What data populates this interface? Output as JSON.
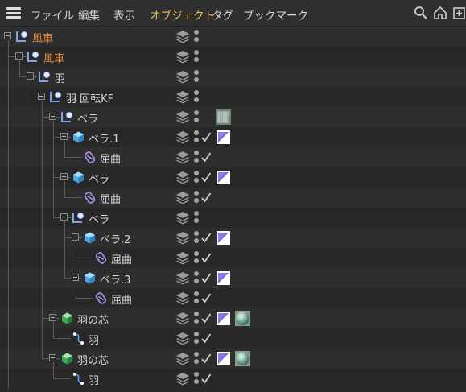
{
  "menu": {
    "items": [
      "ファイル",
      "編集",
      "表示",
      "オブジェクト",
      "タグ",
      "ブックマーク"
    ],
    "active_index": 3
  },
  "toolbar_icons": [
    "search-icon",
    "home-icon",
    "new-view-icon"
  ],
  "colors": {
    "active_menu": "#e6c457",
    "selected_object": "#e38b3d",
    "background": "#2a2a2a"
  },
  "tree": [
    {
      "name": "風車",
      "depth": 0,
      "icon": "null-icon",
      "selected": true,
      "expander": true,
      "check": false,
      "tags": []
    },
    {
      "name": "風車",
      "depth": 1,
      "icon": "null-icon",
      "selected": true,
      "expander": true,
      "check": false,
      "tags": []
    },
    {
      "name": "羽",
      "depth": 2,
      "icon": "null-icon",
      "selected": false,
      "expander": true,
      "check": false,
      "tags": []
    },
    {
      "name": "羽 回転KF",
      "depth": 3,
      "icon": "null-icon",
      "selected": false,
      "expander": true,
      "check": false,
      "tags": []
    },
    {
      "name": "ベラ",
      "depth": 4,
      "icon": "null-icon",
      "selected": false,
      "expander": true,
      "check": false,
      "tags": [
        "texture-thumbnail"
      ]
    },
    {
      "name": "ベラ.1",
      "depth": 5,
      "icon": "cube-icon",
      "selected": false,
      "expander": true,
      "check": true,
      "tags": [
        "phong-tag-icon"
      ]
    },
    {
      "name": "屈曲",
      "depth": 6,
      "icon": "bend-deformer-icon",
      "selected": false,
      "expander": false,
      "check": true,
      "tags": []
    },
    {
      "name": "ベラ",
      "depth": 5,
      "icon": "cube-icon",
      "selected": false,
      "expander": true,
      "check": true,
      "tags": [
        "phong-tag-icon"
      ]
    },
    {
      "name": "屈曲",
      "depth": 6,
      "icon": "bend-deformer-icon",
      "selected": false,
      "expander": false,
      "check": true,
      "tags": []
    },
    {
      "name": "ベラ",
      "depth": 5,
      "icon": "null-icon",
      "selected": false,
      "expander": true,
      "check": false,
      "tags": []
    },
    {
      "name": "ベラ.2",
      "depth": 6,
      "icon": "cube-icon",
      "selected": false,
      "expander": true,
      "check": true,
      "tags": [
        "phong-tag-icon"
      ]
    },
    {
      "name": "屈曲",
      "depth": 7,
      "icon": "bend-deformer-icon",
      "selected": false,
      "expander": false,
      "check": true,
      "tags": []
    },
    {
      "name": "ベラ.3",
      "depth": 6,
      "icon": "cube-icon",
      "selected": false,
      "expander": true,
      "check": true,
      "tags": [
        "phong-tag-icon"
      ]
    },
    {
      "name": "屈曲",
      "depth": 7,
      "icon": "bend-deformer-icon",
      "selected": false,
      "expander": false,
      "check": true,
      "tags": []
    },
    {
      "name": "羽の芯",
      "depth": 4,
      "icon": "green-cube-icon",
      "selected": false,
      "expander": true,
      "check": true,
      "tags": [
        "phong-tag-icon",
        "material-ball"
      ]
    },
    {
      "name": "羽",
      "depth": 5,
      "icon": "spline-icon",
      "selected": false,
      "expander": false,
      "check": true,
      "tags": []
    },
    {
      "name": "羽の芯",
      "depth": 4,
      "icon": "green-cube-icon",
      "selected": false,
      "expander": true,
      "check": true,
      "tags": [
        "phong-tag-icon",
        "material-ball"
      ]
    },
    {
      "name": "羽",
      "depth": 5,
      "icon": "spline-icon",
      "selected": false,
      "expander": false,
      "check": true,
      "tags": []
    }
  ]
}
